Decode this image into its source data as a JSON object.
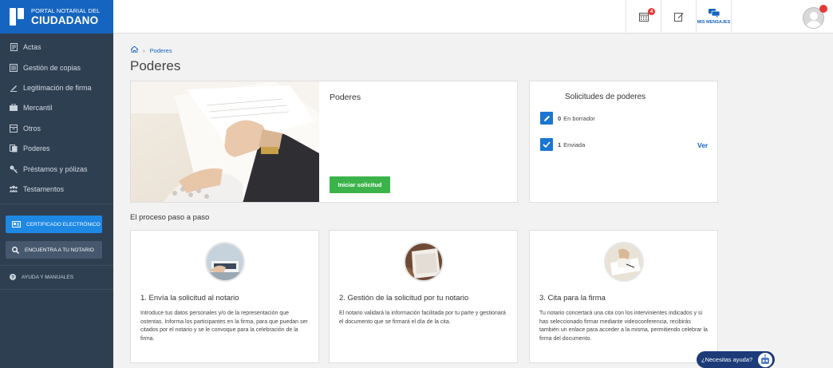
{
  "brand": {
    "line1": "PORTAL NOTARIAL DEL",
    "line2": "CIUDADANO",
    "color": "#1565c0"
  },
  "topbar": {
    "calendar_badge": "4",
    "messages_label": "MIS MENSAJES"
  },
  "sidebar": {
    "items": [
      {
        "label": "Actas",
        "icon": "actas-icon"
      },
      {
        "label": "Gestión de copias",
        "icon": "copias-icon"
      },
      {
        "label": "Legitimación de firma",
        "icon": "firma-icon"
      },
      {
        "label": "Mercantil",
        "icon": "briefcase-icon"
      },
      {
        "label": "Otros",
        "icon": "box-icon"
      },
      {
        "label": "Poderes",
        "icon": "documents-icon"
      },
      {
        "label": "Préstamos y pólizas",
        "icon": "key-icon"
      },
      {
        "label": "Testamentos",
        "icon": "people-icon"
      }
    ],
    "cert_button": "CERTIFICADO ELECTRÓNICO",
    "notario_button": "ENCUENTRA A TU NOTARIO",
    "help": "AYUDA Y MANUALES"
  },
  "breadcrumb": {
    "current": "Poderes"
  },
  "page": {
    "title": "Poderes"
  },
  "main_card": {
    "title": "Poderes",
    "button": "Iniciar solicitud"
  },
  "solicitudes": {
    "title": "Solicitudes de poderes",
    "rows": [
      {
        "count": "0",
        "label": "En borrador"
      },
      {
        "count": "1",
        "label": "Enviada"
      }
    ],
    "ver_link": "Ver"
  },
  "process": {
    "title": "El proceso paso a paso",
    "steps": [
      {
        "title": "1. Envía la solicitud al notario",
        "desc": "Introduce tus datos personales y/o de la representación que ostentas. Informa los participantes en la firma, para que puedan ser citados por el notario y se le convoque para la celebración de la firma."
      },
      {
        "title": "2. Gestión de la solicitud por tu notario",
        "desc": "El notario validará la información facilitada por tu parte y gestionará el documento que se firmará el día de la cita."
      },
      {
        "title": "3. Cita para la firma",
        "desc": "Tu notario concertará una cita con los intervinientes indicados y si has seleccionado firmar mediante videoconferencia, recibirás también un enlace para acceder a la misma, permitiendo celebrar la firma del documento."
      }
    ]
  },
  "help_widget": {
    "label": "¿Necesitas ayuda?"
  }
}
